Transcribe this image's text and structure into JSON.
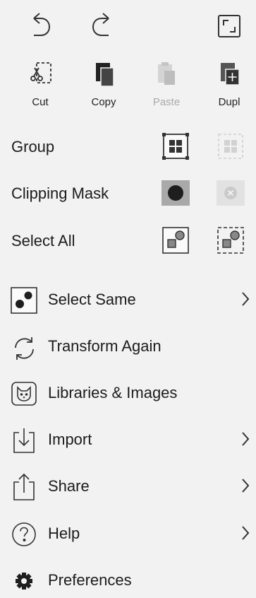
{
  "toolbar": {
    "tools": [
      {
        "label": "Cut"
      },
      {
        "label": "Copy"
      },
      {
        "label": "Paste"
      },
      {
        "label": "Dupl"
      }
    ]
  },
  "object_rows": [
    {
      "label": "Group"
    },
    {
      "label": "Clipping Mask"
    },
    {
      "label": "Select All"
    }
  ],
  "menu": [
    {
      "label": "Select Same",
      "icon": "select-same-icon",
      "has_submenu": true
    },
    {
      "label": "Transform Again",
      "icon": "transform-again-icon",
      "has_submenu": false
    },
    {
      "label": "Libraries & Images",
      "icon": "cat-icon",
      "has_submenu": false
    },
    {
      "label": "Import",
      "icon": "import-icon",
      "has_submenu": true
    },
    {
      "label": "Share",
      "icon": "share-icon",
      "has_submenu": true
    },
    {
      "label": "Help",
      "icon": "help-icon",
      "has_submenu": true
    },
    {
      "label": "Preferences",
      "icon": "gear-icon",
      "has_submenu": false
    }
  ],
  "colors": {
    "background": "#f2f2f2",
    "text": "#1c1c1c",
    "disabled": "#a9a9a9"
  }
}
